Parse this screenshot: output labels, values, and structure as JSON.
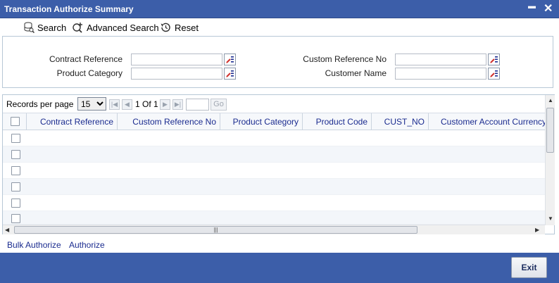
{
  "window": {
    "title": "Transaction Authorize Summary",
    "minimize_glyph": "▬",
    "close_glyph": "✕"
  },
  "toolbar": {
    "search_label": "Search",
    "advanced_search_label": "Advanced Search",
    "reset_label": "Reset"
  },
  "search_form": {
    "contract_reference_label": "Contract Reference",
    "product_category_label": "Product Category",
    "custom_reference_no_label": "Custom Reference No",
    "customer_name_label": "Customer Name",
    "contract_reference_value": "",
    "product_category_value": "",
    "custom_reference_no_value": "",
    "customer_name_value": ""
  },
  "pager": {
    "records_per_page_label": "Records per page",
    "records_per_page_value": "15",
    "page_info": "1 Of 1",
    "goto_value": "",
    "go_label": "Go"
  },
  "grid": {
    "columns": [
      "Contract Reference",
      "Custom Reference No",
      "Product Category",
      "Product Code",
      "CUST_NO",
      "Customer Account Currency"
    ]
  },
  "links": {
    "bulk_authorize": "Bulk Authorize",
    "authorize": "Authorize"
  },
  "footer": {
    "exit_label": "Exit"
  },
  "colors": {
    "title_bar": "#3c5ea9",
    "link": "#1a2b8f",
    "border": "#b7c7d6"
  },
  "icons": [
    "search-icon",
    "advanced-search-icon",
    "reset-icon",
    "lov-icon",
    "first-page-icon",
    "prev-page-icon",
    "next-page-icon",
    "last-page-icon"
  ]
}
